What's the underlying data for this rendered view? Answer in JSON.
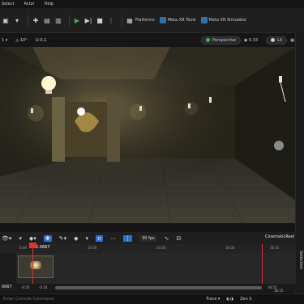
{
  "menu": {
    "items": [
      "Select",
      "Actor",
      "Help"
    ]
  },
  "toolbar": {
    "platforms": "Platforms",
    "meta_xr_tools": "Meta XR Tools",
    "meta_xr_sim": "Meta XR Simulator"
  },
  "viewport_toolbar": {
    "grid_snap": "1",
    "rot_snap": "10°",
    "scale_snap": "0.1",
    "perspective": "Perspective",
    "speed": "0.33",
    "lit": "Lit"
  },
  "viewport": {
    "colors": {
      "floor_light": "#3b3830",
      "floor_dark": "#2e2c26",
      "wall": "#242218",
      "lamp": "#fff7d0"
    }
  },
  "sequencer": {
    "fps": "30 fps",
    "label": "CinematicReel",
    "current_time": "2.0667",
    "ticks": [
      "0.00",
      "10.00",
      "20.00",
      "30.00",
      "38.55"
    ],
    "left_value": "0667",
    "range_start_1": "-0.50",
    "range_start_2": "-0.50",
    "range_end_1": "38.55",
    "range_end_2": "38.55",
    "selection": "Selection"
  },
  "status": {
    "command_placeholder": "Enter Console Command",
    "trace": "Trace",
    "zen": "Zen S"
  },
  "accent": "#2f6fd0",
  "playhead_color": "#e03030"
}
